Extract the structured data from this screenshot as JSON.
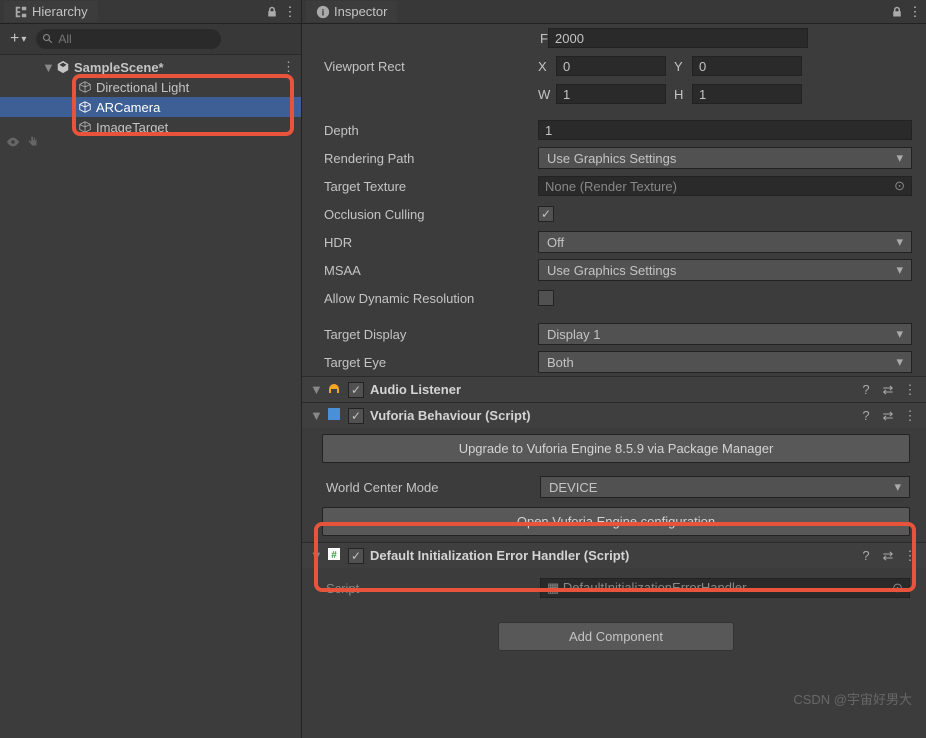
{
  "hierarchy": {
    "title": "Hierarchy",
    "search_placeholder": "All",
    "scene": "SampleScene*",
    "items": [
      "Directional Light",
      "ARCamera",
      "ImageTarget"
    ],
    "selected_index": 1
  },
  "inspector": {
    "title": "Inspector",
    "far_label": "Far",
    "far": "2000",
    "viewport_label": "Viewport Rect",
    "x_label": "X",
    "x": "0",
    "y_label": "Y",
    "y": "0",
    "w_label": "W",
    "w": "1",
    "h_label": "H",
    "h": "1",
    "depth_label": "Depth",
    "depth": "1",
    "rendering_path_label": "Rendering Path",
    "rendering_path": "Use Graphics Settings",
    "target_texture_label": "Target Texture",
    "target_texture": "None (Render Texture)",
    "occlusion_label": "Occlusion Culling",
    "occlusion": true,
    "hdr_label": "HDR",
    "hdr": "Off",
    "msaa_label": "MSAA",
    "msaa": "Use Graphics Settings",
    "allow_dynres_label": "Allow Dynamic Resolution",
    "allow_dynres": false,
    "target_display_label": "Target Display",
    "target_display": "Display 1",
    "target_eye_label": "Target Eye",
    "target_eye": "Both",
    "audio_listener": "Audio Listener",
    "vuforia_behaviour": "Vuforia Behaviour (Script)",
    "upgrade_btn": "Upgrade to Vuforia Engine 8.5.9 via Package Manager",
    "world_center_label": "World Center Mode",
    "world_center": "DEVICE",
    "open_vuforia_btn": "Open Vuforia Engine configuration",
    "default_init": "Default Initialization Error Handler (Script)",
    "script_label": "Script",
    "script_value": "DefaultInitializationErrorHandler",
    "add_component": "Add Component"
  },
  "watermark": "CSDN @宇宙好男大"
}
